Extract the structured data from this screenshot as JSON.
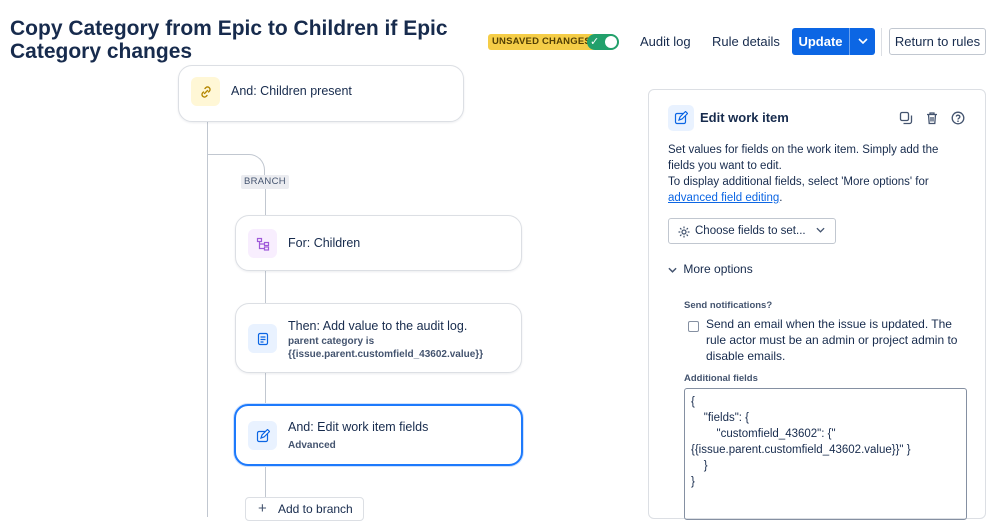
{
  "header": {
    "title": "Copy Category from Epic to Children if Epic Category changes",
    "badge": "UNSAVED CHANGES",
    "audit_log": "Audit log",
    "rule_details": "Rule details",
    "update": "Update",
    "return": "Return to rules"
  },
  "flow": {
    "card_children_present": "And: Children present",
    "branch_label": "BRANCH",
    "card_for_children": "For: Children",
    "card_audit_title": "Then: Add value to the audit log.",
    "card_audit_sub1": "parent category is",
    "card_audit_sub2": "{{issue.parent.customfield_43602.value}}",
    "card_edit_title": "And: Edit work item fields",
    "card_edit_sub": "Advanced",
    "add_to_branch": "Add to branch"
  },
  "panel": {
    "title": "Edit work item",
    "desc_line1": "Set values for fields on the work item. Simply add the",
    "desc_line2": "fields you want to edit.",
    "desc_line3": "To display additional fields, select 'More options' for",
    "desc_link": "advanced field editing",
    "desc_end": ".",
    "choose_fields": "Choose fields to set...",
    "more_options": "More options",
    "send_notifications_label": "Send notifications?",
    "send_email_text": "Send an email when the issue is updated. The rule actor must be an admin or project admin to disable emails.",
    "additional_fields_label": "Additional fields",
    "json": "{\n    \"fields\": {\n        \"customfield_43602\": {\"\n{{issue.parent.customfield_43602.value}}\" }\n    }\n}"
  },
  "colors": {
    "primary": "#0c66e4",
    "badge": "#f5cd47",
    "toggle_on": "#22a06b",
    "selected_border": "#1d7afc"
  }
}
